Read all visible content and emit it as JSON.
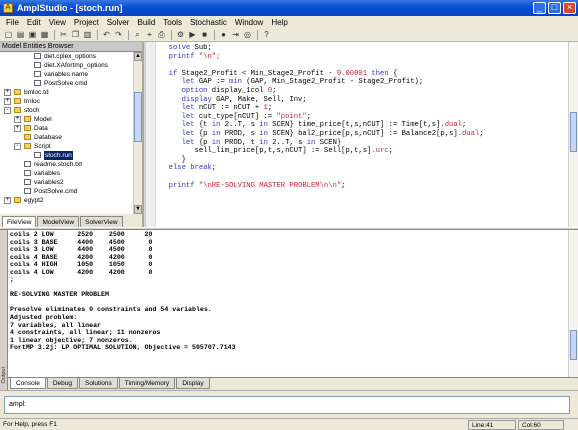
{
  "window": {
    "title": "AmplStudio - [stoch.run]"
  },
  "menu": [
    "File",
    "Edit",
    "View",
    "Project",
    "Solver",
    "Build",
    "Tools",
    "Stochastic",
    "Window",
    "Help"
  ],
  "browser": {
    "title": "Model Entities Browser",
    "items": [
      {
        "label": "diet.cplex_options",
        "level": 2,
        "kind": "file",
        "expander": ""
      },
      {
        "label": "diet.XAfortmp_options",
        "level": 2,
        "kind": "file",
        "expander": ""
      },
      {
        "label": "variables name",
        "level": 2,
        "kind": "file",
        "expander": ""
      },
      {
        "label": "PostSolve.cmd",
        "level": 2,
        "kind": "file",
        "expander": ""
      },
      {
        "label": "bmloc.td",
        "level": 0,
        "kind": "folder",
        "expander": "+"
      },
      {
        "label": "trnloc",
        "level": 0,
        "kind": "folder",
        "expander": "+"
      },
      {
        "label": "stoch",
        "level": 0,
        "kind": "folder",
        "expander": "-"
      },
      {
        "label": "Model",
        "level": 1,
        "kind": "folder",
        "expander": "+"
      },
      {
        "label": "Data",
        "level": 1,
        "kind": "folder",
        "expander": "+"
      },
      {
        "label": "Database",
        "level": 1,
        "kind": "folder",
        "expander": ""
      },
      {
        "label": "Script",
        "level": 1,
        "kind": "folder",
        "expander": "-"
      },
      {
        "label": "stoch.run",
        "level": 2,
        "kind": "file",
        "expander": "",
        "selected": true
      },
      {
        "label": "readme.stoch.txt",
        "level": 1,
        "kind": "file",
        "expander": ""
      },
      {
        "label": "variables",
        "level": 1,
        "kind": "file",
        "expander": ""
      },
      {
        "label": "variables2",
        "level": 1,
        "kind": "file",
        "expander": ""
      },
      {
        "label": "PostSolve.cmd",
        "level": 1,
        "kind": "file",
        "expander": ""
      },
      {
        "label": "egypt2",
        "level": 0,
        "kind": "folder",
        "expander": "+"
      }
    ],
    "tabs": [
      "FileView",
      "ModelView",
      "SolverView"
    ],
    "active_tab": "FileView"
  },
  "editor": {
    "lines": [
      [
        [
          "kw",
          "  solve "
        ],
        [
          "pl",
          "Sub;"
        ]
      ],
      [
        [
          "kw",
          "  printf "
        ],
        [
          "cm",
          "\"\\n\";"
        ]
      ],
      [
        [
          "pl",
          ""
        ]
      ],
      [
        [
          "kw",
          "  if "
        ],
        [
          "pl",
          "Stage2_Profit < Min_Stage2_Profit - "
        ],
        [
          "cm",
          "0.00001"
        ],
        [
          "kw",
          " then "
        ],
        [
          "pl",
          "{"
        ]
      ],
      [
        [
          "kw",
          "     let "
        ],
        [
          "pl",
          "GAP := "
        ],
        [
          "kw",
          "min "
        ],
        [
          "pl",
          "(GAP, Min_Stage2_Profit - Stage2_Profit);"
        ]
      ],
      [
        [
          "kw",
          "     option "
        ],
        [
          "pl",
          "display_1col "
        ],
        [
          "cm",
          "0"
        ],
        [
          "pl",
          ";"
        ]
      ],
      [
        [
          "kw",
          "     display "
        ],
        [
          "pl",
          "GAP, Make, Sell, Inv;"
        ]
      ],
      [
        [
          "kw",
          "     let "
        ],
        [
          "pl",
          "nCUT := nCUT + "
        ],
        [
          "cm",
          "1"
        ],
        [
          "pl",
          ";"
        ]
      ],
      [
        [
          "kw",
          "     let "
        ],
        [
          "pl",
          "cut_type[nCUT] := "
        ],
        [
          "cm",
          "\"point\""
        ],
        [
          "pl",
          ";"
        ]
      ],
      [
        [
          "kw",
          "     let "
        ],
        [
          "pl",
          "{t "
        ],
        [
          "kw",
          "in "
        ],
        [
          "pl",
          "2..T, s "
        ],
        [
          "kw",
          "in "
        ],
        [
          "pl",
          "SCEN} time_price[t,s,nCUT] := Time[t,s]"
        ],
        [
          "cm",
          ".dual"
        ],
        [
          "pl",
          ";"
        ]
      ],
      [
        [
          "kw",
          "     let "
        ],
        [
          "pl",
          "{p "
        ],
        [
          "kw",
          "in "
        ],
        [
          "pl",
          "PROD, s "
        ],
        [
          "kw",
          "in "
        ],
        [
          "pl",
          "SCEN} bal2_price[p,s,nCUT] := Balance2[p,s]"
        ],
        [
          "cm",
          ".dual"
        ],
        [
          "pl",
          ";"
        ]
      ],
      [
        [
          "kw",
          "     let "
        ],
        [
          "pl",
          "{p "
        ],
        [
          "kw",
          "in "
        ],
        [
          "pl",
          "PROD, t "
        ],
        [
          "kw",
          "in "
        ],
        [
          "pl",
          "2..T, s "
        ],
        [
          "kw",
          "in "
        ],
        [
          "pl",
          "SCEN}"
        ]
      ],
      [
        [
          "pl",
          "        sell_lim_price[p,t,s,nCUT] := Sell[p,t,s]"
        ],
        [
          "cm",
          ".urc"
        ],
        [
          "pl",
          ";"
        ]
      ],
      [
        [
          "pl",
          "     }"
        ]
      ],
      [
        [
          "kw",
          "  else break"
        ],
        [
          "pl",
          ";"
        ]
      ],
      [
        [
          "pl",
          ""
        ]
      ],
      [
        [
          "kw",
          "  printf "
        ],
        [
          "cm",
          "\"\\nRE-SOLVING MASTER PROBLEM\\n\\n\""
        ],
        [
          "pl",
          ";"
        ]
      ]
    ]
  },
  "console": {
    "lines": [
      "coils 2 LOW      2520    2500     20",
      "coils 3 BASE     4400    4500      0",
      "coils 3 LOW      4400    4500      0",
      "coils 4 BASE     4200    4200      0",
      "coils 4 HIGH     1050    1050      0",
      "coils 4 LOW      4200    4200      0",
      ";",
      "",
      "RE-SOLVING MASTER PROBLEM",
      "",
      "Presolve eliminates 0 constraints and 54 variables.",
      "Adjusted problem:",
      "7 variables, all linear",
      "4 constraints, all linear; 11 nonzeros",
      "1 linear objective; 7 nonzeros.",
      "FortMP 3.2j: LP OPTIMAL SOLUTION, Objective = 505707.7143"
    ],
    "tabs": [
      "Console",
      "Debug",
      "Solutions",
      "Timing/Memory",
      "Display"
    ],
    "active_tab": "Console",
    "side_label": "Output"
  },
  "prompt": {
    "label": "ampl:",
    "value": ""
  },
  "status": {
    "help_text": "For Help, press F1",
    "line": "Line:41",
    "col": "Col:60"
  }
}
